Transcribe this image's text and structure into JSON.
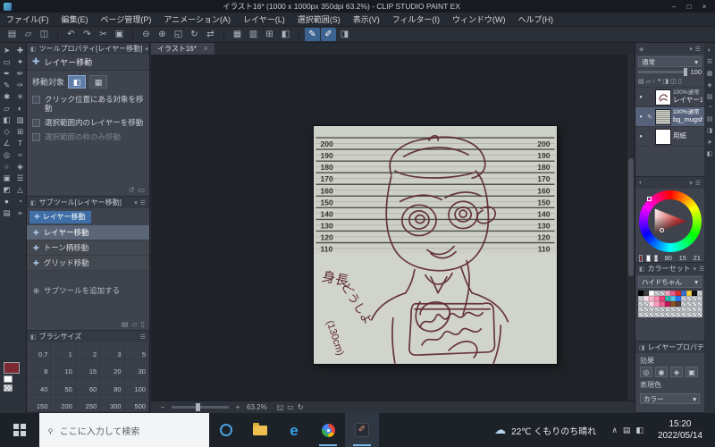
{
  "colors": {
    "sketch": "#5d2731",
    "accent_blue": "#3f6fa6",
    "selection": "#56627a",
    "main_swatch": "#7e2a35"
  },
  "title_bar": {
    "title": "イラスト16* (1000 x 1000px 350dpi 63.2%) - CLIP STUDIO PAINT EX",
    "minimize": "–",
    "maximize": "□",
    "close": "×"
  },
  "menu_bar": {
    "items": [
      "ファイル(F)",
      "編集(E)",
      "ページ管理(P)",
      "アニメーション(A)",
      "レイヤー(L)",
      "選択範囲(S)",
      "表示(V)",
      "フィルター(I)",
      "ウィンドウ(W)",
      "ヘルプ(H)"
    ]
  },
  "toolbar": {
    "icons": [
      {
        "name": "new-file-icon",
        "glyph": "▤"
      },
      {
        "name": "open-file-icon",
        "glyph": "▱"
      },
      {
        "name": "save-icon",
        "glyph": "◫"
      },
      {
        "sep": true
      },
      {
        "name": "undo-icon",
        "glyph": "↶"
      },
      {
        "name": "redo-icon",
        "glyph": "↷"
      },
      {
        "name": "cut-icon",
        "glyph": "✂"
      },
      {
        "name": "copy-icon",
        "glyph": "▣"
      },
      {
        "sep": true
      },
      {
        "name": "zoom-out-icon",
        "glyph": "⊖"
      },
      {
        "name": "zoom-in-icon",
        "glyph": "⊕"
      },
      {
        "name": "fit-screen-icon",
        "glyph": "◱"
      },
      {
        "name": "rotate-view-icon",
        "glyph": "↻"
      },
      {
        "name": "flip-view-icon",
        "glyph": "⇄"
      },
      {
        "sep": true
      },
      {
        "name": "grid-icon",
        "glyph": "▦"
      },
      {
        "name": "ruler-icon",
        "glyph": "▥"
      },
      {
        "name": "snap-grid-icon",
        "glyph": "⊞"
      },
      {
        "name": "snap-ruler-icon",
        "glyph": "◧"
      },
      {
        "sep": true
      },
      {
        "name": "snap-pen-icon",
        "glyph": "✎",
        "active": true
      },
      {
        "name": "snap-special-ruler-icon",
        "glyph": "✐",
        "active": true
      },
      {
        "name": "material-panel-icon",
        "glyph": "◨"
      }
    ]
  },
  "tool_strip": {
    "icons": [
      {
        "name": "operation-tool-icon",
        "glyph": "➤"
      },
      {
        "name": "layer-move-tool-icon",
        "glyph": "✚"
      },
      {
        "name": "selection-tool-icon",
        "glyph": "▭"
      },
      {
        "name": "auto-select-tool-icon",
        "glyph": "✦"
      },
      {
        "name": "eyedropper-tool-icon",
        "glyph": "✒"
      },
      {
        "name": "pen-tool-icon",
        "glyph": "✏"
      },
      {
        "name": "pencil-tool-icon",
        "glyph": "✎"
      },
      {
        "name": "brush-tool-icon",
        "glyph": "✑"
      },
      {
        "name": "watercolor-tool-icon",
        "glyph": "✱"
      },
      {
        "name": "airbrush-tool-icon",
        "glyph": "✳"
      },
      {
        "name": "eraser-tool-icon",
        "glyph": "▱"
      },
      {
        "name": "blend-tool-icon",
        "glyph": "◐"
      },
      {
        "name": "fill-tool-icon",
        "glyph": "◧"
      },
      {
        "name": "gradient-tool-icon",
        "glyph": "▨"
      },
      {
        "name": "figure-tool-icon",
        "glyph": "◇"
      },
      {
        "name": "frame-border-tool-icon",
        "glyph": "⊞"
      },
      {
        "name": "ruler-tool-icon",
        "glyph": "∠"
      },
      {
        "name": "text-tool-icon",
        "glyph": "T"
      },
      {
        "name": "balloon-tool-icon",
        "glyph": "◎"
      },
      {
        "name": "line-correction-tool-icon",
        "glyph": "≈"
      },
      {
        "name": "zoom-tool-icon",
        "glyph": "○"
      },
      {
        "name": "material-tool-icon",
        "glyph": "◈"
      },
      {
        "name": "decoration-tool-icon",
        "glyph": "▣"
      },
      {
        "name": "story-tool-icon",
        "glyph": "☰"
      },
      {
        "name": "mask-tool-icon",
        "glyph": "◩"
      },
      {
        "name": "symmetry-tool-icon",
        "glyph": "△"
      },
      {
        "name": "dot-tool-icon",
        "glyph": "●"
      },
      {
        "name": "tone-tool-icon",
        "glyph": "◔"
      },
      {
        "name": "grid-tool-icon",
        "glyph": "▤"
      },
      {
        "name": "navigate-tool-icon",
        "glyph": "➢"
      }
    ]
  },
  "tool_property": {
    "title": "ツールプロパティ[レイヤー移動]",
    "tool_name": "レイヤー移動",
    "move_target_label": "移動対象",
    "options": [
      {
        "label": "クリック位置にある対象を移動",
        "checked": false,
        "disabled": false
      },
      {
        "label": "選択範囲内のレイヤーを移動",
        "checked": false,
        "disabled": false
      },
      {
        "label": "選択範囲の枠のみ移動",
        "checked": false,
        "disabled": true
      }
    ]
  },
  "sub_tool": {
    "title": "サブツール[レイヤー移動]",
    "tab_label": "レイヤー移動",
    "items": [
      {
        "label": "レイヤー移動",
        "selected": true
      },
      {
        "label": "トーン柄移動",
        "selected": false
      },
      {
        "label": "グリッド移動",
        "selected": false
      }
    ],
    "add_label": "サブツールを追加する",
    "add_icon": "⊕"
  },
  "brush_size": {
    "title": "ブラシサイズ",
    "values": [
      "0.7",
      "1",
      "2",
      "3",
      "5",
      "8",
      "10",
      "15",
      "20",
      "30",
      "40",
      "50",
      "60",
      "80",
      "100",
      "150",
      "200",
      "250",
      "300",
      "500"
    ]
  },
  "canvas": {
    "tab_label": "イラスト16*",
    "tab_close": "×",
    "paper_color": "#d1d4cc",
    "lines_bg_color": "#cdd0c7",
    "line_color": "#4e4f49",
    "number_color": "#35362f",
    "height_marks": [
      "200",
      "190",
      "180",
      "170",
      "160",
      "150",
      "140",
      "130",
      "120",
      "110"
    ],
    "annotations": [
      "身長",
      "どうしよ",
      "(130cm)"
    ],
    "status": {
      "zoom_value": "63.2%"
    }
  },
  "layer_panel": {
    "blend_mode": "通常",
    "opacity": "100",
    "layers": [
      {
        "info": "100%通常",
        "name": "レイヤー1",
        "visible": true,
        "editing": false,
        "selected": false,
        "thumb": "sketch"
      },
      {
        "info": "100%通常",
        "name": "bg_mugshot_cm",
        "visible": true,
        "editing": true,
        "selected": true,
        "thumb": "mugshot"
      },
      {
        "info": "",
        "name": "用紙",
        "visible": true,
        "editing": false,
        "selected": false,
        "thumb": "paper"
      }
    ]
  },
  "color_panel": {
    "rgb": [
      "80",
      "15",
      "21"
    ]
  },
  "color_set": {
    "title": "カラーセット",
    "set_name": "ハイドちゃん",
    "swatches": [
      "#000000",
      "#404040",
      "#ffffff",
      "chk",
      "chk",
      "#f3a6bf",
      "#ec5f8d",
      "#e03131",
      "#3b6fd4",
      "#f5d33f",
      "#141414",
      "chk",
      "chk",
      "#fce4ec",
      "#f8bbd0",
      "#f48fb1",
      "#ec407a",
      "#30b8a8",
      "#53c7e8",
      "#2979ff",
      "chk",
      "chk",
      "chk",
      "chk",
      "chk",
      "chk",
      "#ffd9e5",
      "#ff9ec0",
      "#f06292",
      "#c2185b",
      "#8d5524",
      "#5d4037",
      "chk",
      "chk",
      "chk",
      "chk",
      "chk",
      "chk",
      "chk",
      "chk",
      "chk",
      "chk",
      "chk",
      "chk",
      "chk",
      "chk",
      "chk",
      "chk",
      "chk",
      "chk",
      "chk",
      "chk",
      "chk",
      "chk",
      "chk",
      "chk",
      "chk",
      "chk",
      "chk",
      "chk"
    ]
  },
  "layer_property": {
    "title": "レイヤープロパティ",
    "effect_label": "効果",
    "expression_label": "表現色",
    "expression_value": "カラー"
  },
  "taskbar": {
    "search_placeholder": "ここに入力して検索",
    "weather": "22℃ くもりのち晴れ",
    "time": "15:20",
    "date": "2022/05/14"
  }
}
